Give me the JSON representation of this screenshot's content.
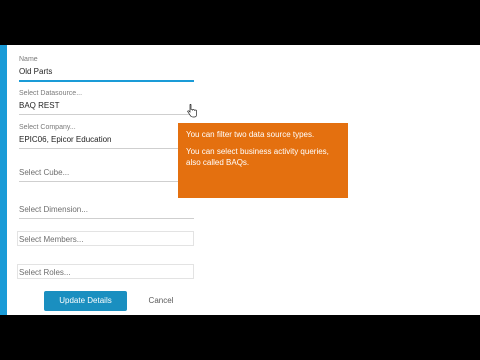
{
  "form": {
    "name": {
      "label": "Name",
      "value": "Old Parts"
    },
    "datasource": {
      "label": "Select Datasource...",
      "value": "BAQ REST"
    },
    "company": {
      "label": "Select Company...",
      "value": "EPIC06, Epicor Education"
    },
    "cube": {
      "placeholder": "Select Cube..."
    },
    "dimension": {
      "placeholder": "Select Dimension..."
    },
    "members": {
      "placeholder": "Select Members..."
    },
    "roles": {
      "placeholder": "Select Roles..."
    }
  },
  "buttons": {
    "update_label": "Update Details",
    "cancel_label": "Cancel"
  },
  "tooltip": {
    "line1": "You can filter two data source types.",
    "line2": "You can select business activity queries, also called BAQs."
  },
  "colors": {
    "accent": "#1a9bd7",
    "primary_button": "#1a8fc0",
    "tooltip_bg": "#e4700f"
  },
  "icons": {
    "cursor": "hand-pointer-icon"
  }
}
